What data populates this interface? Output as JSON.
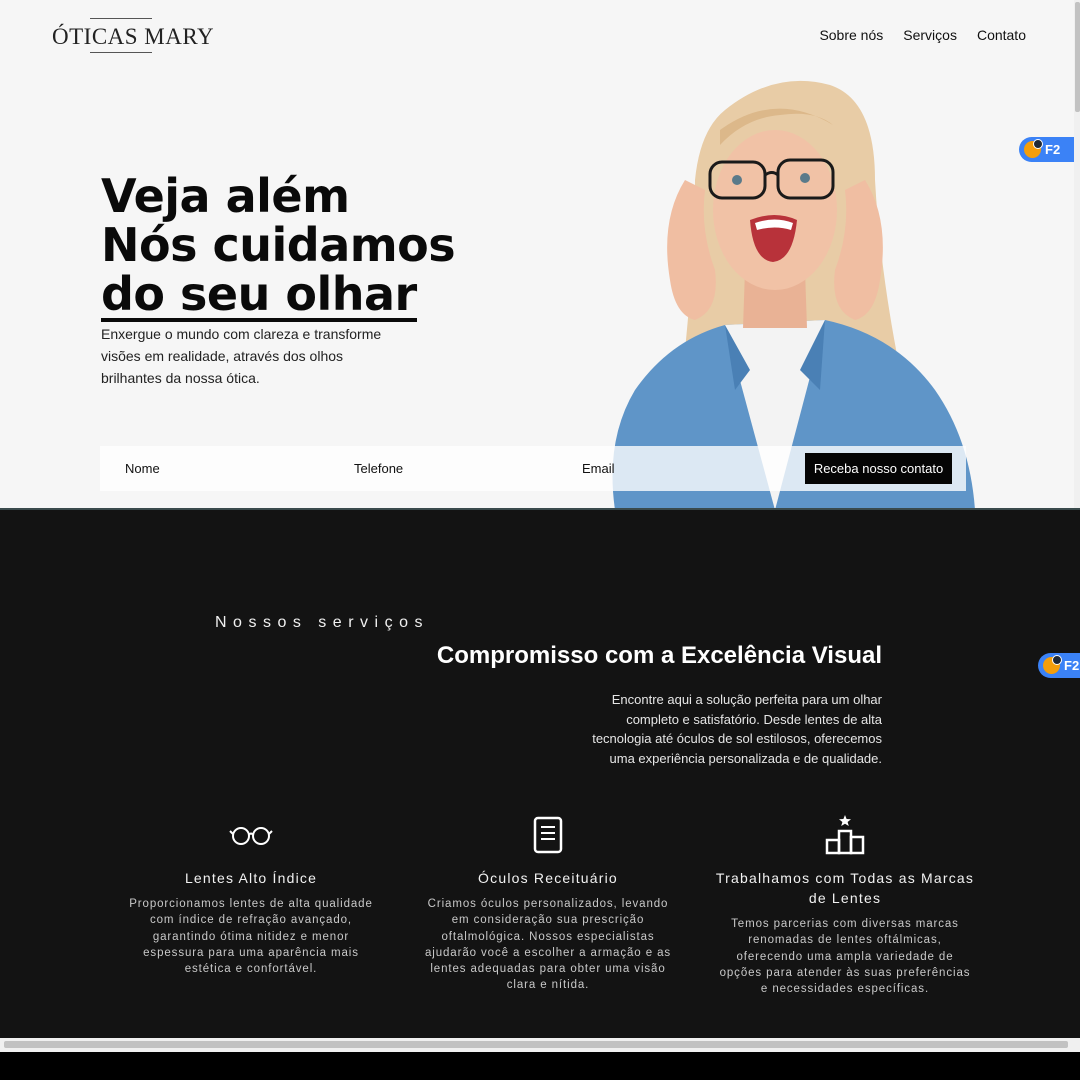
{
  "brand": {
    "name": "ÓTICAS MARY"
  },
  "nav": {
    "items": [
      "Sobre nós",
      "Serviços",
      "Contato"
    ]
  },
  "hero": {
    "line1": "Veja além",
    "line2": "Nós cuidamos",
    "line3": "do seu olhar",
    "subtitle": "Enxergue o mundo com clareza e transforme visões em realidade, através dos olhos brilhantes da nossa ótica."
  },
  "form": {
    "name_placeholder": "Nome",
    "phone_placeholder": "Telefone",
    "email_placeholder": "Email",
    "submit_label": "Receba nosso contato"
  },
  "extension_badge": {
    "label": "F2",
    "color": "#3b82f6"
  },
  "services": {
    "eyebrow": "Nossos serviços",
    "title": "Compromisso com a Excelência Visual",
    "description": "Encontre aqui a solução perfeita para um olhar completo e satisfatório. Desde lentes de alta tecnologia até óculos de sol estilosos, oferecemos uma experiência personalizada e de qualidade.",
    "cards": [
      {
        "icon": "glasses-icon",
        "title": "Lentes Alto Índice",
        "text": "Proporcionamos lentes de alta qualidade com índice de refração avançado, garantindo ótima nitidez e menor espessura para uma aparência mais estética e confortável."
      },
      {
        "icon": "document-icon",
        "title": "Óculos Receituário",
        "text": "Criamos óculos personalizados, levando em consideração sua prescrição oftalmológica. Nossos especialistas ajudarão você a escolher a armação e as lentes adequadas para obter uma visão clara e nítida."
      },
      {
        "icon": "podium-star-icon",
        "title": "Trabalhamos com Todas as Marcas de Lentes",
        "text": "Temos parcerias com diversas marcas renomadas de lentes oftálmicas, oferecendo uma ampla variedade de opções para atender às suas preferências e necessidades específicas."
      }
    ]
  },
  "colors": {
    "hero_bg": "#f6f6f6",
    "dark_bg": "#131313",
    "button_bg": "#050505",
    "denim": "#5d93c6",
    "hair": "#e6c9a0"
  }
}
